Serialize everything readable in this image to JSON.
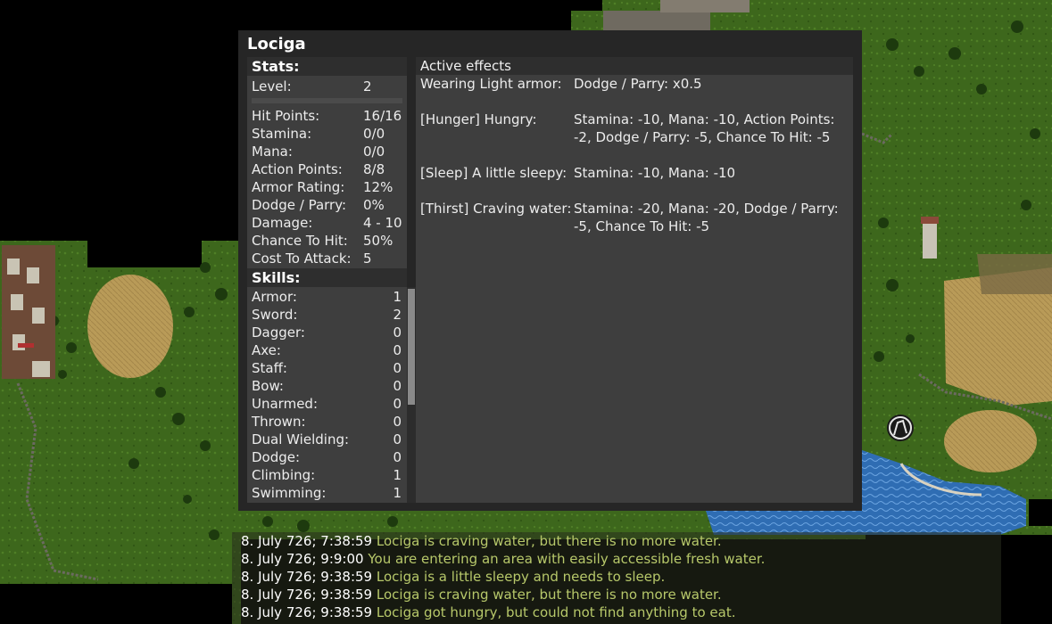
{
  "character": {
    "name": "Lociga"
  },
  "stats": {
    "heading": "Stats:",
    "level_label": "Level:",
    "level_value": "2",
    "xp_progress": 0,
    "rows": [
      {
        "label": "Hit Points:",
        "value": "16/16"
      },
      {
        "label": "Stamina:",
        "value": "0/0"
      },
      {
        "label": "Mana:",
        "value": "0/0"
      },
      {
        "label": "Action Points:",
        "value": "8/8"
      },
      {
        "label": "Armor Rating:",
        "value": "12%"
      },
      {
        "label": "Dodge / Parry:",
        "value": "0%"
      },
      {
        "label": "Damage:",
        "value": "4 - 10"
      },
      {
        "label": "Chance To Hit:",
        "value": "50%"
      },
      {
        "label": "Cost To Attack:",
        "value": "5"
      }
    ]
  },
  "skills": {
    "heading": "Skills:",
    "rows": [
      {
        "label": "Armor:",
        "value": "1"
      },
      {
        "label": "Sword:",
        "value": "2"
      },
      {
        "label": "Dagger:",
        "value": "0"
      },
      {
        "label": "Axe:",
        "value": "0"
      },
      {
        "label": "Staff:",
        "value": "0"
      },
      {
        "label": "Bow:",
        "value": "0"
      },
      {
        "label": "Unarmed:",
        "value": "0"
      },
      {
        "label": "Thrown:",
        "value": "0"
      },
      {
        "label": "Dual Wielding:",
        "value": "0"
      },
      {
        "label": "Dodge:",
        "value": "0"
      },
      {
        "label": "Climbing:",
        "value": "1"
      },
      {
        "label": "Swimming:",
        "value": "1"
      }
    ]
  },
  "effects": {
    "heading": "Active effects",
    "items": [
      {
        "name": "Wearing Light armor:",
        "desc": "Dodge / Parry: x0.5"
      },
      {
        "name": "[Hunger] Hungry:",
        "desc": "Stamina: -10, Mana: -10, Action Points: -2, Dodge / Parry: -5, Chance To Hit: -5"
      },
      {
        "name": "[Sleep] A little sleepy:",
        "desc": "Stamina: -10, Mana: -10"
      },
      {
        "name": "[Thirst] Craving water:",
        "desc": "Stamina: -20, Mana: -20, Dodge / Parry: -5, Chance To Hit: -5"
      }
    ]
  },
  "log": [
    {
      "time": "8. July 726; 7:38:59",
      "message": "Lociga is craving water, but there is no more water."
    },
    {
      "time": "8. July 726; 9:9:00",
      "message": "You are entering an area with easily accessible fresh water."
    },
    {
      "time": "8. July 726; 9:38:59",
      "message": "Lociga is a little sleepy and needs to sleep."
    },
    {
      "time": "8. July 726; 9:38:59",
      "message": "Lociga is craving water, but there is no more water."
    },
    {
      "time": "8. July 726; 9:38:59",
      "message": "Lociga got hungry, but could not find anything to eat."
    }
  ],
  "colors": {
    "window_bg": "#262626",
    "panel_bg": "#3e3e3e",
    "log_message": "#b7c86a",
    "grass": "#3f6a1e",
    "water": "#2f6fb6",
    "field": "#b89a55"
  }
}
